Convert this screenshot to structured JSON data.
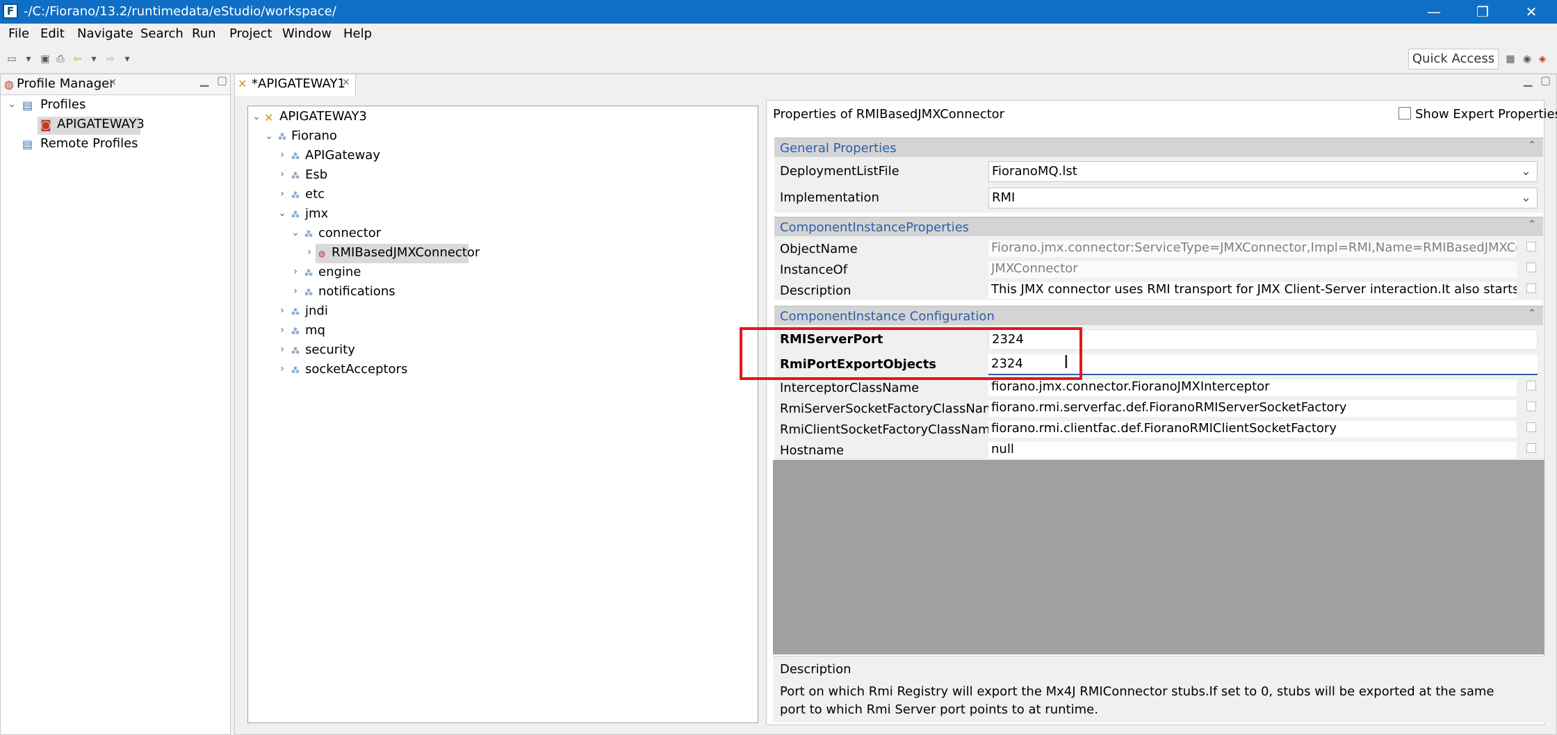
{
  "window": {
    "title": "-/C:/Fiorano/13.2/runtimedata/eStudio/workspace/",
    "controls": [
      "—",
      "❐",
      "✕"
    ]
  },
  "menubar": [
    "File",
    "Edit",
    "Navigate",
    "Search",
    "Run",
    "Project",
    "Window",
    "Help"
  ],
  "toolbar": {
    "quick_access": "Quick Access"
  },
  "profile_manager": {
    "tab_label": "Profile Manager",
    "tree": {
      "profiles_label": "Profiles",
      "selected_profile": "APIGATEWAY3",
      "remote_profiles_label": "Remote Profiles"
    }
  },
  "editor": {
    "tab_label": "*APIGATEWAY1",
    "tree": {
      "root": "APIGATEWAY3",
      "fiorano": "Fiorano",
      "apigateway": "APIGateway",
      "esb": "Esb",
      "etc": "etc",
      "jmx": "jmx",
      "connector": "connector",
      "rmi_connector": "RMIBasedJMXConnector",
      "engine": "engine",
      "notifications": "notifications",
      "jndi": "jndi",
      "mq": "mq",
      "security": "security",
      "socket_acceptors": "socketAcceptors"
    }
  },
  "properties": {
    "header": "Properties of RMIBasedJMXConnector",
    "show_expert": "Show Expert Properties",
    "general": {
      "title": "General Properties",
      "deployment_label": "DeploymentListFile",
      "deployment_value": "FioranoMQ.lst",
      "implementation_label": "Implementation",
      "implementation_value": "RMI"
    },
    "instance_props": {
      "title": "ComponentInstanceProperties",
      "objectname_label": "ObjectName",
      "objectname_value": "Fiorano.jmx.connector:ServiceType=JMXConnector,Impl=RMI,Name=RMIBasedJMXConnector",
      "instanceof_label": "InstanceOf",
      "instanceof_value": "JMXConnector",
      "description_label": "Description",
      "description_value": "This JMX connector uses RMI transport for JMX Client-Server interaction.It also starts the rmi regi"
    },
    "instance_config": {
      "title": "ComponentInstance Configuration",
      "rmiserverport_label": "RMIServerPort",
      "rmiserverport_value": "2324",
      "rmiportexport_label": "RmiPortExportObjects",
      "rmiportexport_value": "2324",
      "interceptor_label": "InterceptorClassName",
      "interceptor_value": "fiorano.jmx.connector.FioranoJMXInterceptor",
      "serverfactory_label": "RmiServerSocketFactoryClassName",
      "serverfactory_value": "fiorano.rmi.serverfac.def.FioranoRMIServerSocketFactory",
      "clientfactory_label": "RmiClientSocketFactoryClassName",
      "clientfactory_value": "fiorano.rmi.clientfac.def.FioranoRMIClientSocketFactory",
      "hostname_label": "Hostname",
      "hostname_value": "null"
    },
    "description": {
      "title": "Description",
      "text": "Port on which Rmi Registry will export the Mx4J RMIConnector stubs.If set to 0, stubs will be exported at the same port to which Rmi Server port points to at runtime."
    }
  },
  "colors": {
    "title_bar": "#0f6fc6",
    "section_title": "#2c5fa8",
    "highlight_box": "#e8141c"
  }
}
